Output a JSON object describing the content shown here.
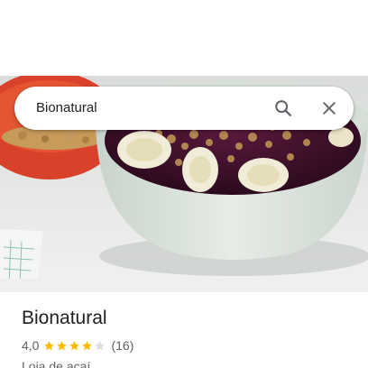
{
  "search": {
    "query": "Bionatural"
  },
  "place": {
    "name": "Bionatural",
    "rating": "4,0",
    "rating_value": 4.0,
    "max_rating": 5,
    "review_count": "(16)",
    "category": "Loja de açaí"
  },
  "icons": {
    "search": "search-icon",
    "close": "close-icon",
    "star": "star-icon"
  },
  "colors": {
    "star_filled": "#fbbc04",
    "star_empty": "#dadce0",
    "icon": "#5f6368",
    "text_primary": "#202124",
    "text_secondary": "#5f6368"
  }
}
